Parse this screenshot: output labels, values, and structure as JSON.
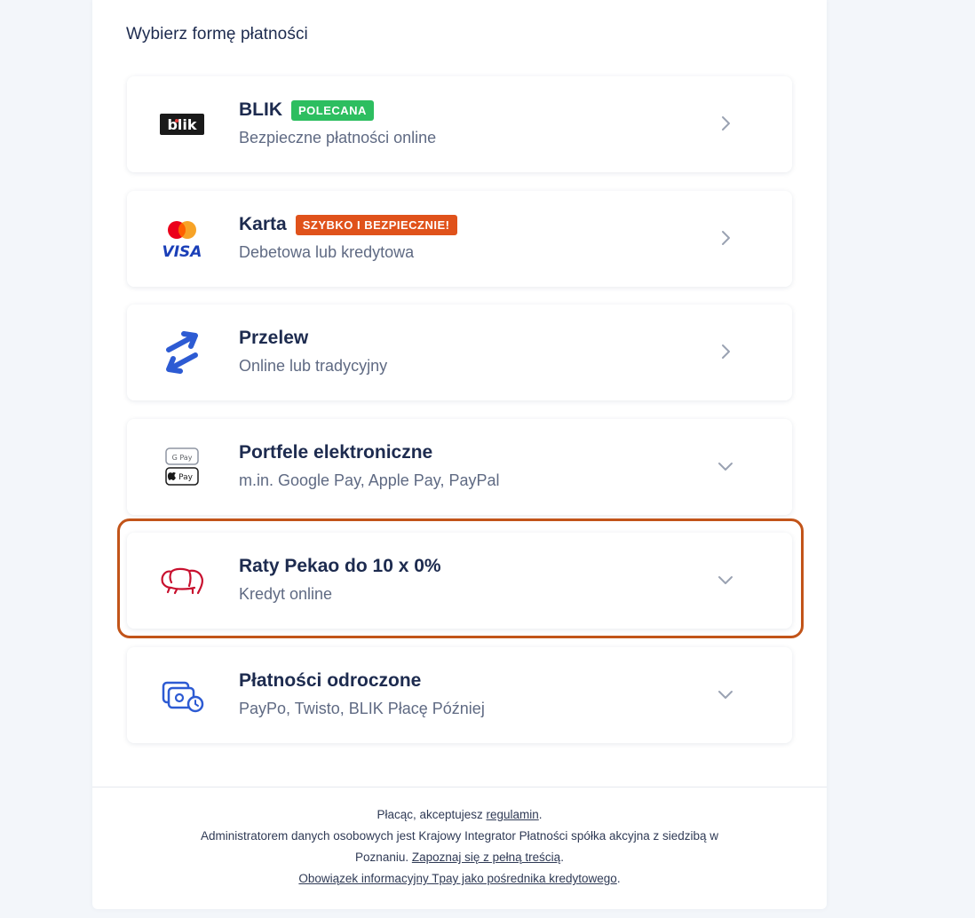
{
  "section_title": "Wybierz formę płatności",
  "methods": [
    {
      "name": "BLIK",
      "badge": "POLECANA",
      "badge_color": "#2dbe60",
      "desc": "Bezpieczne płatności online",
      "logo": "blik-logo",
      "arrow": "chevron-right-icon"
    },
    {
      "name": "Karta",
      "badge": "SZYBKO I BEZPIECZNIE!",
      "badge_color": "#e0521b",
      "desc": "Debetowa lub kredytowa",
      "logo": "mastercard-visa-logo",
      "visa_text": "VISA",
      "arrow": "chevron-right-icon"
    },
    {
      "name": "Przelew",
      "desc": "Online lub tradycyjny",
      "logo": "transfer-arrows-icon",
      "arrow": "chevron-right-icon"
    },
    {
      "name": "Portfele elektroniczne",
      "desc": "m.in. Google Pay, Apple Pay, PayPal",
      "logo": "wallets-icon",
      "gpay_text": "G Pay",
      "applepay_text": "Pay",
      "arrow": "chevron-down-icon"
    },
    {
      "name": "Raty Pekao do 10 x 0%",
      "desc": "Kredyt online",
      "logo": "pekao-bison-logo",
      "arrow": "chevron-down-icon"
    },
    {
      "name": "Płatności odroczone",
      "desc": "PayPo, Twisto, BLIK Płacę Później",
      "logo": "deferred-payment-icon",
      "arrow": "chevron-down-icon"
    }
  ],
  "footer": {
    "line1_prefix": "Płacąc, akceptujesz ",
    "line1_link": "regulamin",
    "line1_suffix": ".",
    "line2": "Administratorem danych osobowych jest Krajowy Integrator Płatności spółka akcyjna z siedzibą w",
    "line3_prefix": "Poznaniu. ",
    "line3_link": "Zapoznaj się z pełną treścią",
    "line3_suffix": ".",
    "line4_link": "Obowiązek informacyjny Tpay jako pośrednika kredytowego",
    "line4_suffix": "."
  },
  "colors": {
    "highlight": "#c25419",
    "text": "#1d2b4f",
    "muted": "#5f6a83",
    "blue": "#2d5bd3",
    "pekao_red": "#c8102e"
  }
}
